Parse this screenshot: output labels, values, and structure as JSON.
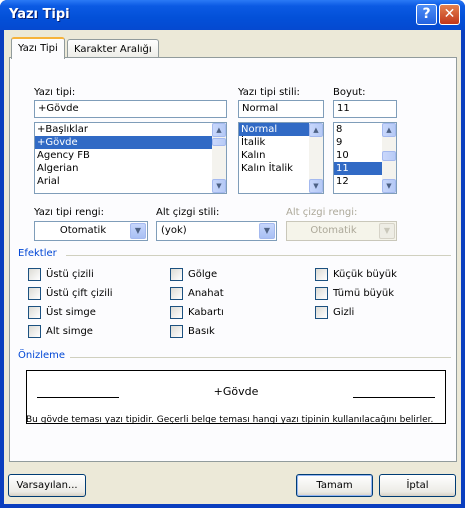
{
  "window": {
    "title": "Yazı Tipi",
    "help_glyph": "?",
    "close_glyph": "✕"
  },
  "tabs": [
    {
      "label": "Yazı Tipi",
      "active": true
    },
    {
      "label": "Karakter Aralığı",
      "active": false
    }
  ],
  "font": {
    "label": "Yazı tipi:",
    "value": "+Gövde",
    "items": [
      "+Başlıklar",
      "+Gövde",
      "Agency FB",
      "Algerian",
      "Arial"
    ],
    "selected_index": 1
  },
  "style": {
    "label": "Yazı tipi stili:",
    "value": "Normal",
    "items": [
      "Normal",
      "İtalik",
      "Kalın",
      "Kalın İtalik"
    ],
    "selected_index": 0
  },
  "size": {
    "label": "Boyut:",
    "value": "11",
    "items": [
      "8",
      "9",
      "10",
      "11",
      "12"
    ],
    "selected_index": 3
  },
  "font_color": {
    "label": "Yazı tipi rengi:",
    "value": "Otomatik"
  },
  "underline_style": {
    "label": "Alt çizgi stili:",
    "value": "(yok)"
  },
  "underline_color": {
    "label": "Alt çizgi rengi:",
    "value": "Otomatik"
  },
  "effects": {
    "title": "Efektler",
    "items": [
      {
        "label": "Üstü çizili",
        "checked": false
      },
      {
        "label": "Üstü çift çizili",
        "checked": false
      },
      {
        "label": "Üst simge",
        "checked": false
      },
      {
        "label": "Alt simge",
        "checked": false
      },
      {
        "label": "Gölge",
        "checked": false
      },
      {
        "label": "Anahat",
        "checked": false
      },
      {
        "label": "Kabartı",
        "checked": false
      },
      {
        "label": "Basık",
        "checked": false
      },
      {
        "label": "Küçük büyük",
        "checked": false
      },
      {
        "label": "Tümü büyük",
        "checked": false
      },
      {
        "label": "Gizli",
        "checked": false
      }
    ]
  },
  "preview": {
    "title": "Önizleme",
    "sample": "+Gövde",
    "note": "Bu gövde teması yazı tipidir. Geçerli belge teması hangi yazı tipinin kullanılacağını belirler."
  },
  "buttons": {
    "default": "Varsayılan...",
    "ok": "Tamam",
    "cancel": "İptal"
  },
  "colors": {
    "titlebar": "#0350d8",
    "selection": "#316ac5",
    "group_title": "#0046d5",
    "dialog_bg": "#ece9d8"
  }
}
